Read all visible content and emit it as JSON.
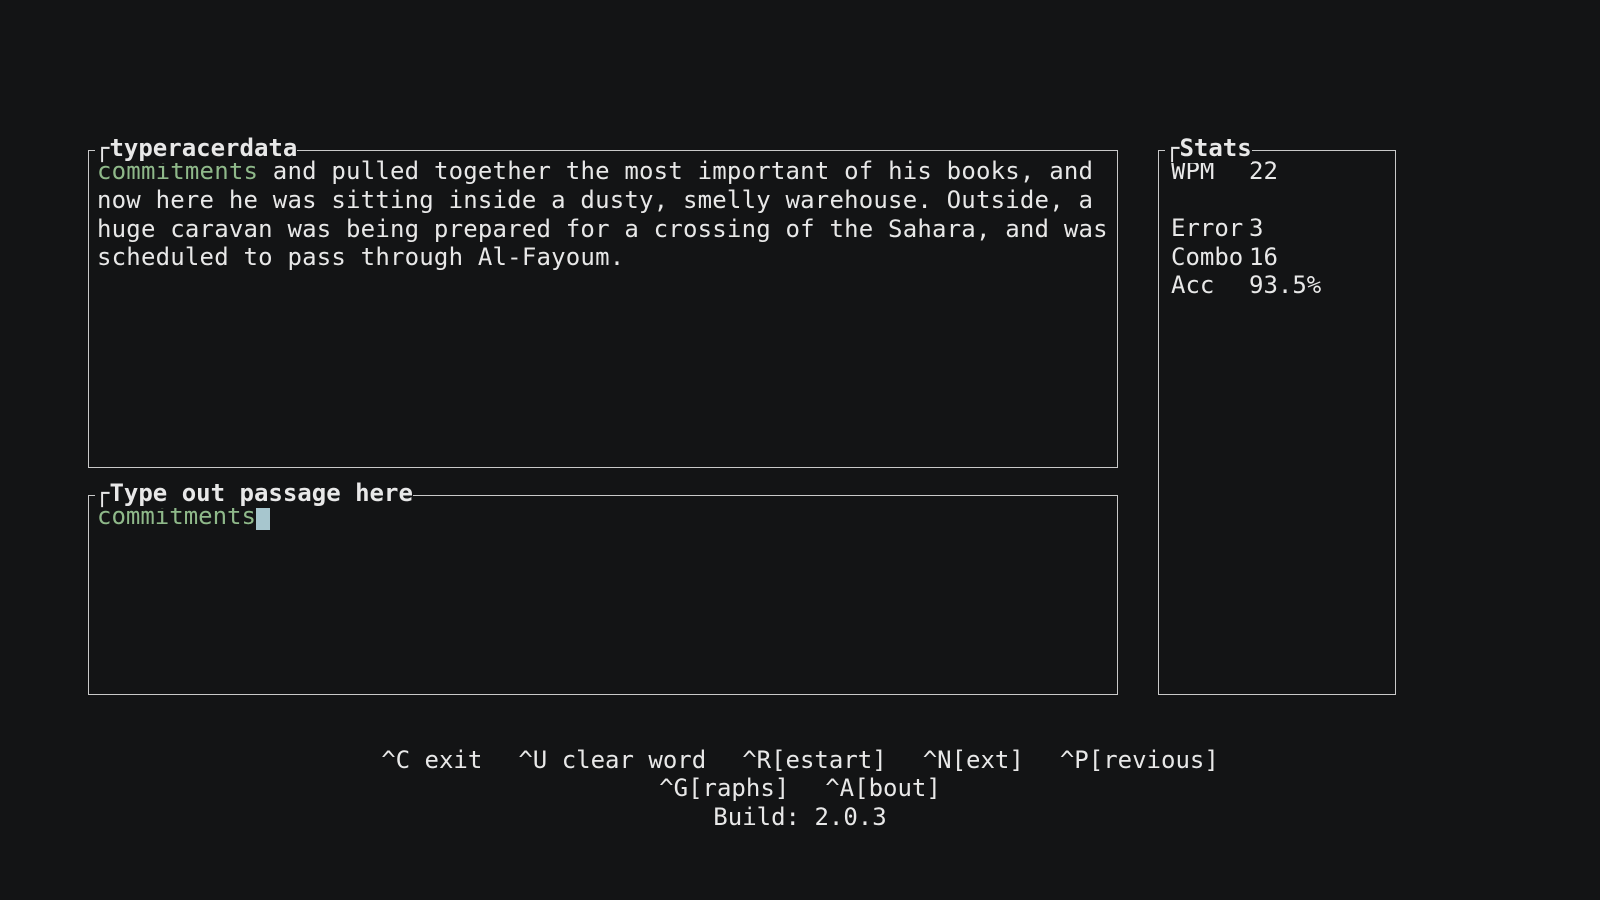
{
  "passage_panel": {
    "title": "typeracerdata",
    "typed": "commitments",
    "rest": " and pulled together the most important of his books, and now here he was sitting inside a dusty, smelly warehouse. Outside, a huge caravan was being prepared for a crossing of the Sahara, and was scheduled to pass through Al-Fayoum."
  },
  "input_panel": {
    "title": "Type out passage here",
    "typed": "commitments"
  },
  "stats_panel": {
    "title": "Stats",
    "wpm_label": "WPM",
    "wpm_value": "22",
    "error_label": "Error",
    "error_value": "3",
    "combo_label": "Combo",
    "combo_value": "16",
    "acc_label": "Acc",
    "acc_value": "93.5%"
  },
  "shortcuts": {
    "exit": "^C exit",
    "clear_word": "^U clear word",
    "restart": "^R[estart]",
    "next": "^N[ext]",
    "previous": "^P[revious]",
    "graphs": "^G[raphs]",
    "about": "^A[bout]"
  },
  "build": {
    "label": "Build: ",
    "version": "2.0.3"
  }
}
